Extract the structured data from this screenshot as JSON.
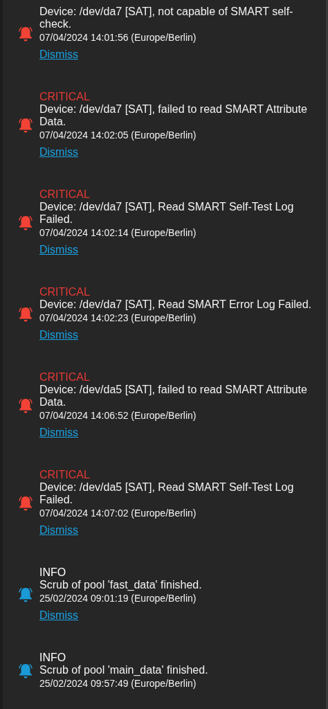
{
  "alerts": [
    {
      "kind": "critical",
      "message": "Device: /dev/da7 [SAT], not capable of SMART self-check.",
      "time": "07/04/2024 14:01:56 (Europe/Berlin)",
      "action": "Dismiss"
    },
    {
      "kind": "critical",
      "level": "CRITICAL",
      "message": "Device: /dev/da7 [SAT], failed to read SMART Attribute Data.",
      "time": "07/04/2024 14:02:05 (Europe/Berlin)",
      "action": "Dismiss"
    },
    {
      "kind": "critical",
      "level": "CRITICAL",
      "message": "Device: /dev/da7 [SAT], Read SMART Self-Test Log Failed.",
      "time": "07/04/2024 14:02:14 (Europe/Berlin)",
      "action": "Dismiss"
    },
    {
      "kind": "critical",
      "level": "CRITICAL",
      "message": "Device: /dev/da7 [SAT], Read SMART Error Log Failed.",
      "time": "07/04/2024 14:02:23 (Europe/Berlin)",
      "action": "Dismiss"
    },
    {
      "kind": "critical",
      "level": "CRITICAL",
      "message": "Device: /dev/da5 [SAT], failed to read SMART Attribute Data.",
      "time": "07/04/2024 14:06:52 (Europe/Berlin)",
      "action": "Dismiss"
    },
    {
      "kind": "critical",
      "level": "CRITICAL",
      "message": "Device: /dev/da5 [SAT], Read SMART Self-Test Log Failed.",
      "time": "07/04/2024 14:07:02 (Europe/Berlin)",
      "action": "Dismiss"
    },
    {
      "kind": "info",
      "level": "INFO",
      "message": "Scrub of pool 'fast_data' finished.",
      "time": "25/02/2024 09:01:19 (Europe/Berlin)",
      "action": "Dismiss"
    },
    {
      "kind": "info",
      "level": "INFO",
      "message": "Scrub of pool 'main_data' finished.",
      "time": "25/02/2024 09:57:49 (Europe/Berlin)"
    }
  ]
}
